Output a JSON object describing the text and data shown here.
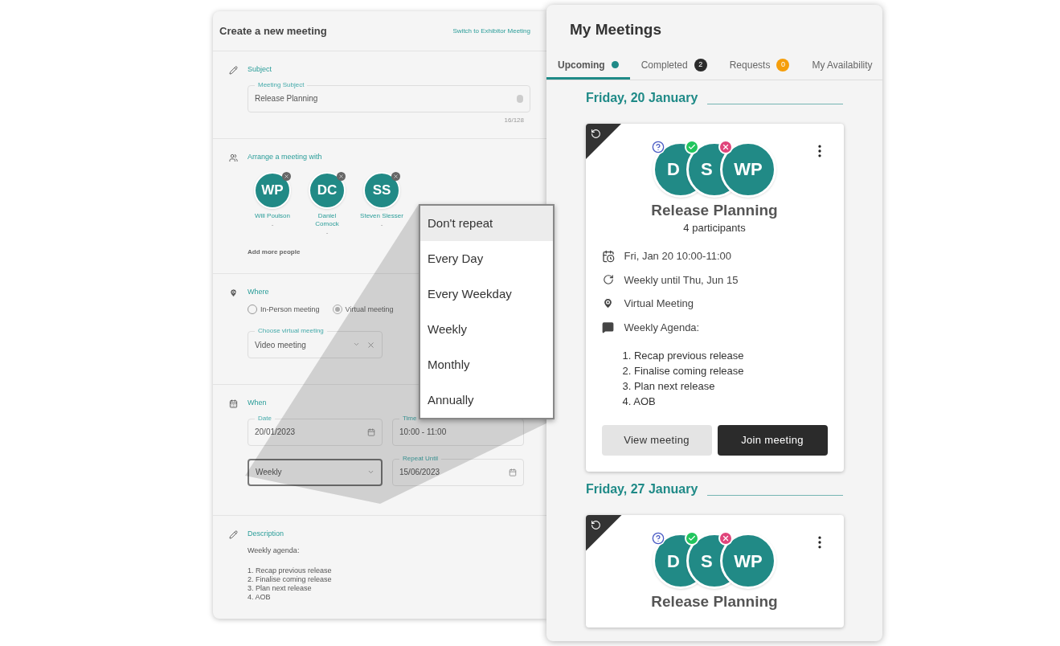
{
  "form": {
    "title": "Create a new meeting",
    "switch_link": "Switch to Exhibitor Meeting",
    "subject": {
      "label": "Subject",
      "field_label": "Meeting Subject",
      "value": "Release Planning",
      "counter": "16/128"
    },
    "attendees": {
      "label": "Arrange a meeting with",
      "people": [
        {
          "initials": "WP",
          "name": "Will Poulson",
          "note": "-"
        },
        {
          "initials": "DC",
          "name": "Daniel Comock",
          "note": "-"
        },
        {
          "initials": "SS",
          "name": "Steven Slesser",
          "note": "-"
        }
      ],
      "add_more": "Add more people"
    },
    "where": {
      "label": "Where",
      "options": [
        {
          "label": "In-Person meeting",
          "selected": false
        },
        {
          "label": "Virtual meeting",
          "selected": true
        }
      ],
      "field_label": "Choose virtual meeting",
      "value": "Video meeting"
    },
    "when": {
      "label": "When",
      "date_label": "Date",
      "date": "20/01/2023",
      "time_label": "Time",
      "time": "10:00 - 11:00",
      "recurrence": "Weekly",
      "until_label": "Repeat Until",
      "until": "15/06/2023"
    },
    "description": {
      "label": "Description",
      "intro": "Weekly agenda:",
      "items": [
        "1. Recap previous release",
        "2. Finalise coming release",
        "3. Plan next release",
        "4. AOB"
      ]
    }
  },
  "repeat_menu": {
    "options": [
      {
        "label": "Don't repeat",
        "selected": true
      },
      {
        "label": "Every Day",
        "selected": false
      },
      {
        "label": "Every Weekday",
        "selected": false
      },
      {
        "label": "Weekly",
        "selected": false
      },
      {
        "label": "Monthly",
        "selected": false
      },
      {
        "label": "Annually",
        "selected": false
      }
    ]
  },
  "meetings_panel": {
    "title": "My Meetings",
    "tabs": [
      {
        "label": "Upcoming",
        "selected": true,
        "indicator": {
          "kind": "dot",
          "color": "#1f8a87"
        }
      },
      {
        "label": "Completed",
        "selected": false,
        "indicator": {
          "kind": "count",
          "text": "2",
          "color": "#2b2b2b"
        }
      },
      {
        "label": "Requests",
        "selected": false,
        "indicator": {
          "kind": "count",
          "text": "0",
          "color": "#f59e0b"
        }
      },
      {
        "label": "My Availability",
        "selected": false
      }
    ],
    "days": [
      {
        "date": "Friday, 20 January",
        "meeting": {
          "recurring": true,
          "avatars": [
            {
              "initials": "D",
              "kind": "unknown"
            },
            {
              "initials": "S",
              "kind": "accepted"
            },
            {
              "initials": "WP",
              "kind": "declined"
            }
          ],
          "title": "Release Planning",
          "participants": "4 participants",
          "details": [
            {
              "kind": "date",
              "text": "Fri, Jan 20 10:00-11:00"
            },
            {
              "kind": "repeat",
              "text": "Weekly until Thu, Jun 15"
            },
            {
              "kind": "location",
              "text": "Virtual Meeting"
            },
            {
              "kind": "agenda",
              "text": "Weekly Agenda:"
            }
          ],
          "agenda": [
            "1. Recap previous release",
            "2. Finalise coming release",
            "3. Plan next release",
            "4. AOB"
          ],
          "buttons": [
            {
              "label": "View meeting",
              "kind": "secondary"
            },
            {
              "label": "Join meeting",
              "kind": "primary"
            }
          ]
        }
      },
      {
        "date": "Friday, 27 January",
        "meeting": {
          "recurring": true,
          "avatars": [
            {
              "initials": "D",
              "kind": "unknown"
            },
            {
              "initials": "S",
              "kind": "accepted"
            },
            {
              "initials": "WP",
              "kind": "declined"
            }
          ],
          "title": "Release Planning"
        }
      }
    ]
  }
}
